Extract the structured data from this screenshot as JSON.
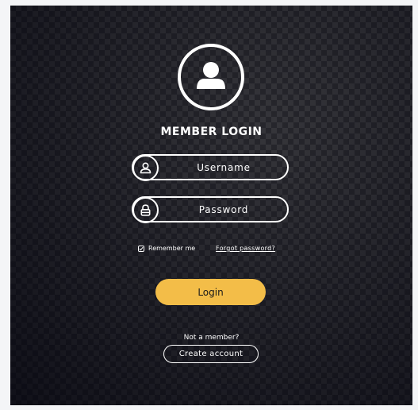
{
  "header": {
    "title": "MEMBER LOGIN",
    "avatar_icon": "user-avatar-icon"
  },
  "form": {
    "username_placeholder": "Username",
    "username_icon": "user-icon",
    "password_placeholder": "Password",
    "password_icon": "lock-icon",
    "remember_label": "Remember me",
    "remember_checked": true,
    "forgot_label": "Forgot password?",
    "login_label": "Login"
  },
  "footer": {
    "not_member_text": "Not a member?",
    "create_account_label": "Create account"
  },
  "colors": {
    "accent": "#f3bd48",
    "panel_bg": "#1f1f24",
    "text": "#ffffff",
    "page_bg": "#f4f5f7"
  }
}
